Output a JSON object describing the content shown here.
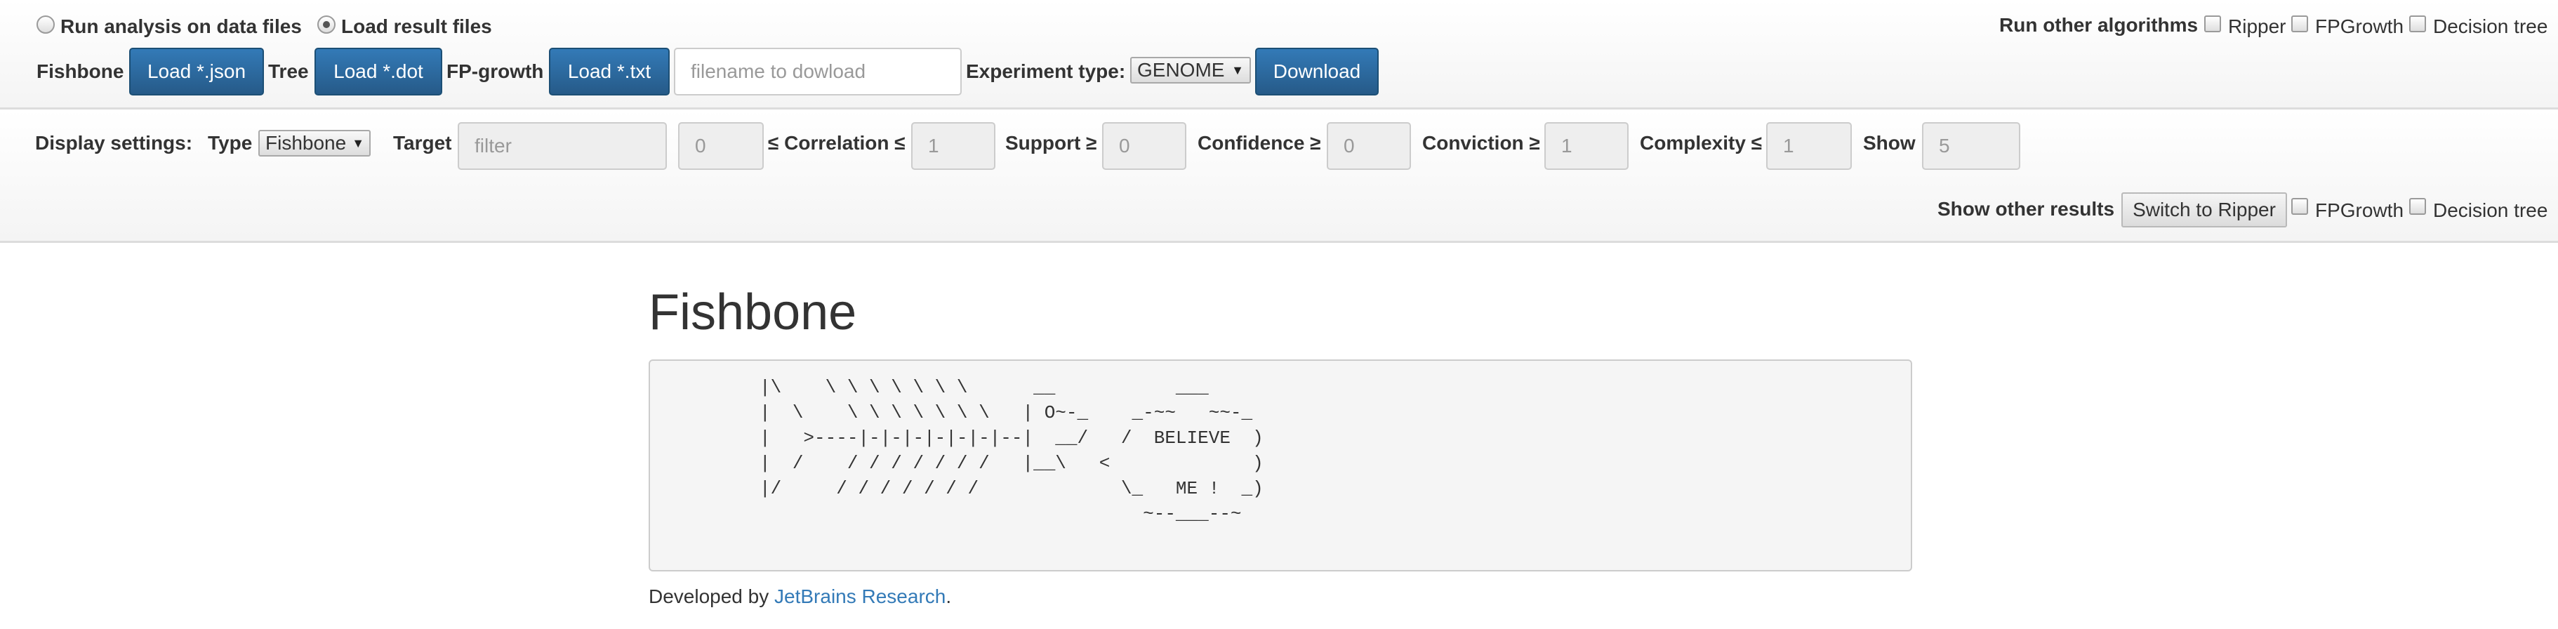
{
  "mode": {
    "run_label": "Run analysis on data files",
    "load_label": "Load result files",
    "selected": "load"
  },
  "loaders": {
    "fishbone_label": "Fishbone",
    "fishbone_button": "Load *.json",
    "tree_label": "Tree",
    "tree_button": "Load *.dot",
    "fpgrowth_label": "FP-growth",
    "fpgrowth_button": "Load *.txt"
  },
  "download": {
    "filename_placeholder": "filename to dowload",
    "experiment_label": "Experiment type:",
    "experiment_value": "GENOME",
    "button": "Download"
  },
  "other_algorithms": {
    "label": "Run other algorithms",
    "options": [
      "Ripper",
      "FPGrowth",
      "Decision tree"
    ]
  },
  "display": {
    "label": "Display settings:",
    "type_label": "Type",
    "type_value": "Fishbone",
    "target_label": "Target",
    "target_placeholder": "filter",
    "target_min": "0",
    "correlation_label": "≤ Correlation ≤",
    "correlation_max": "1",
    "support_label": "Support ≥",
    "support_value": "0",
    "confidence_label": "Confidence ≥",
    "confidence_value": "0",
    "conviction_label": "Conviction ≥",
    "conviction_value": "1",
    "complexity_label": "Complexity ≤",
    "complexity_value": "1",
    "show_label": "Show",
    "show_value": "5"
  },
  "other_results": {
    "label": "Show other results",
    "switch_button": "Switch to Ripper",
    "options": [
      "FPGrowth",
      "Decision tree"
    ]
  },
  "main": {
    "title": "Fishbone",
    "ascii_art": "          |\\    \\ \\ \\ \\ \\ \\ \\      __           ___\n          |  \\    \\ \\ \\ \\ \\ \\ \\   | O~-_    _-~~   ~~-_\n          |   >----|-|-|-|-|-|-|--|  __/   /  BELIEVE  )\n          |  /    / / / / / / /   |__\\   <             )\n          |/     / / / / / / /             \\_   ME !  _)\n                                             ~--___--~",
    "footer_prefix": "Developed by ",
    "footer_link": "JetBrains Research",
    "footer_suffix": "."
  }
}
